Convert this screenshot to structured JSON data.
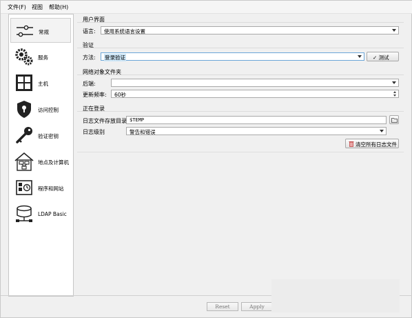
{
  "menu": {
    "file": "文件(F)",
    "view": "视图",
    "help": "帮助(H)"
  },
  "sidebar": {
    "items": [
      {
        "label": "常规",
        "icon": "sliders-icon",
        "selected": true
      },
      {
        "label": "服务",
        "icon": "gears-icon"
      },
      {
        "label": "主机",
        "icon": "grid-icon"
      },
      {
        "label": "访问控制",
        "icon": "shield-lock-icon"
      },
      {
        "label": "验证密钥",
        "icon": "key-icon"
      },
      {
        "label": "地点及计算机",
        "icon": "house-network-icon"
      },
      {
        "label": "程序和网站",
        "icon": "program-window-icon"
      },
      {
        "label": "LDAP Basic",
        "icon": "ldap-database-icon"
      }
    ]
  },
  "ui_section": {
    "title": "用户界面",
    "language_label": "语言:",
    "language_value": "使用系统语言设置"
  },
  "auth_section": {
    "title": "验证",
    "method_label": "方法:",
    "method_value": "登录验证",
    "test_button": "✓ 测试"
  },
  "network_section": {
    "title": "网络对象文件夹",
    "backend_label": "后端:",
    "backend_value": "",
    "refresh_label": "更新频率:",
    "refresh_value": "60秒"
  },
  "logging_section": {
    "title": "正在登录",
    "dir_label": "日志文件存放目录",
    "dir_value": "$TEMP",
    "level_label": "日志级别",
    "level_value": "警告和错误",
    "clear_button": "清空所有日志文件"
  },
  "footer": {
    "reset": "Reset",
    "apply": "Apply"
  }
}
